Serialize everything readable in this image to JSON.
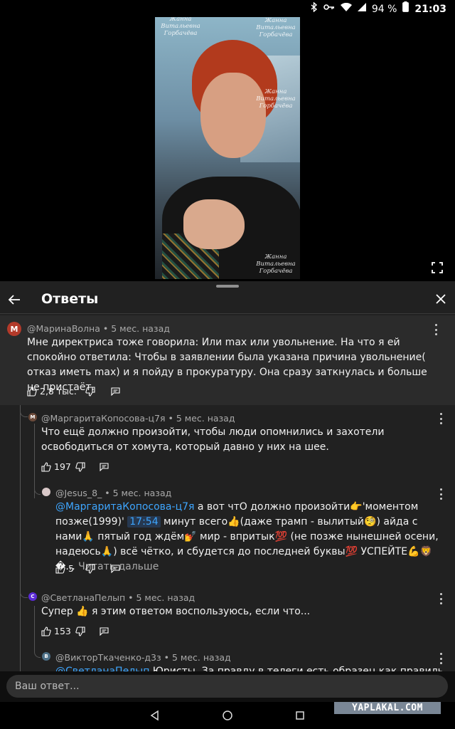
{
  "status_bar": {
    "battery": "94 %",
    "time": "21:03"
  },
  "video": {
    "watermark_name": "Жанна",
    "watermark_patronymic": "Витальевна",
    "watermark_surname": "Горбачёва"
  },
  "panel": {
    "title": "Ответы"
  },
  "comments": [
    {
      "author": "@МаринаВолна",
      "time": "5 мес. назад",
      "avatar_letter": "М",
      "avatar_color": "#b33a2a",
      "text": "Мне директриса тоже говорила: Или max или увольнение. На что я ей спокойно ответила: Чтобы в заявлении была указана причина увольнение( отказ иметь max) и я пойду в прокуратуру. Она сразу заткнулась и больше не пристаёт.",
      "likes": "2,8 тыс."
    },
    {
      "author": "@МаргаритаКопосова-ц7я",
      "time": "5 мес. назад",
      "avatar_letter": "М",
      "avatar_color": "#6b4a3a",
      "text": "Что ещё должно произойти, чтобы люди опомнились и захотели освободиться от хомута, который давно у них на шее.",
      "likes": "197"
    },
    {
      "author": "@Jesus_8_",
      "time": "5 мес. назад",
      "avatar_color": "#d9c8c8",
      "mention": "@МаргаритаКопосова-ц7я",
      "text_part1": " а вот чтО должно произойти👉'моментом позже(1999)' ",
      "timestamp": "17:54",
      "text_part2": " минут всего👍(даже трамп - вылитый🧐) айда с нами🙏 пятый год ждём💅 мир - впритык💯 (не позже нынешней осени, надеюсь🙏) всё чётко, и сбудется до последней буквы💯 УСПЕЙТЕ💪🦁�... ",
      "read_more": "Читать дальше",
      "likes": "5"
    },
    {
      "author": "@СветланаПелып",
      "time": "5 мес. назад",
      "avatar_letter": "С",
      "avatar_color": "#5b2bd6",
      "text": "Супер 👍 я этим ответом воспользуюсь, если что...",
      "likes": "153"
    },
    {
      "author": "@ВикторТкаченко-д3з",
      "time": "5 мес. назад",
      "avatar_letter": "В",
      "avatar_color": "#4c6f86",
      "mention": "@СветланаПелып",
      "text": " Юристы. За правду в телеги есть образец как правильно"
    }
  ],
  "reply_input": {
    "placeholder": "Ваш ответ..."
  },
  "site_watermark": "YAPLAKAL.COM"
}
